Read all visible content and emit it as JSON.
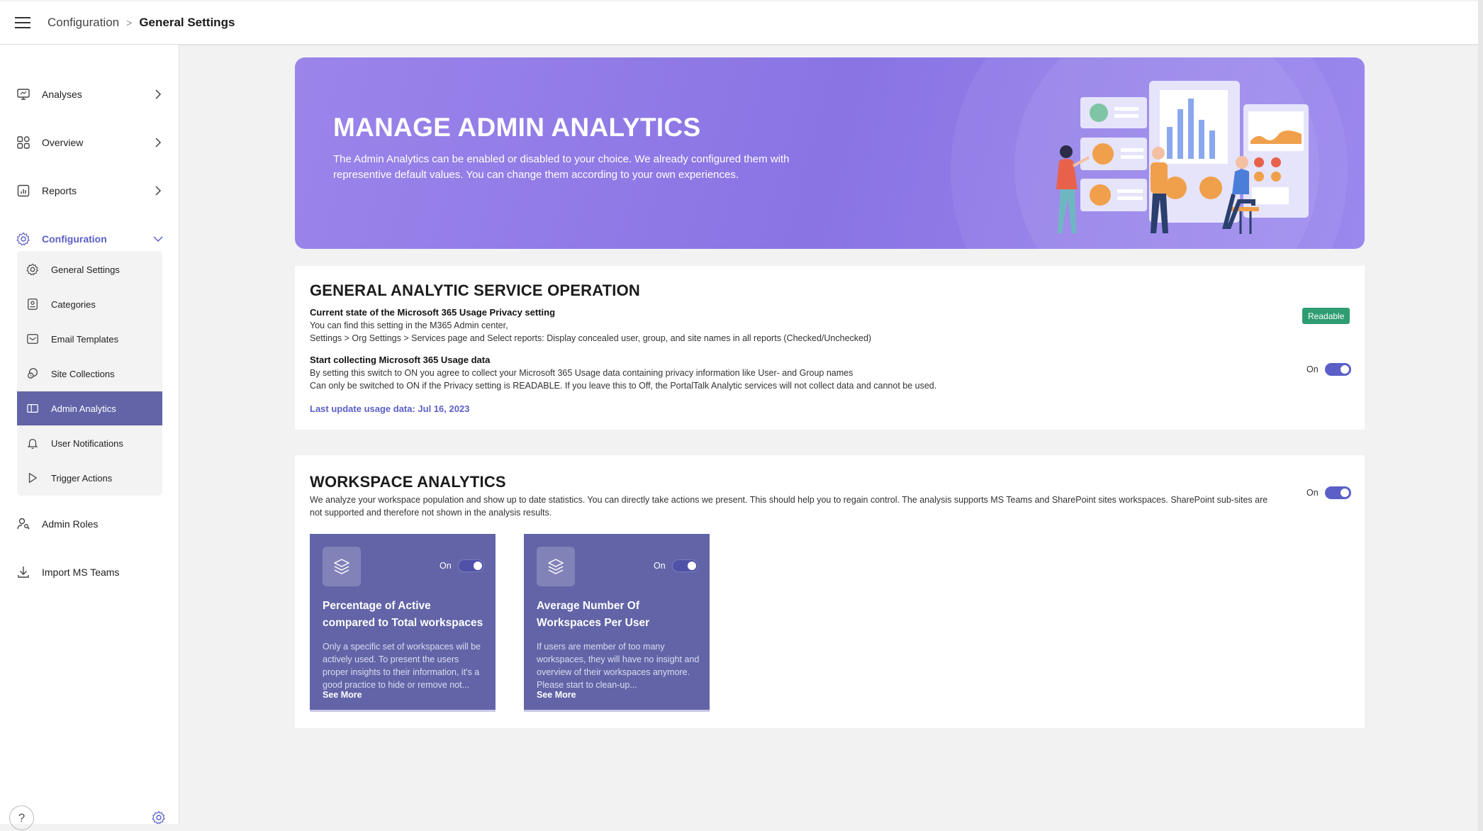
{
  "header": {
    "breadcrumb_parent": "Configuration",
    "breadcrumb_separator": ">",
    "breadcrumb_current": "General Settings"
  },
  "sidebar": {
    "items": [
      {
        "label": "Analyses",
        "icon": "presentation-icon"
      },
      {
        "label": "Overview",
        "icon": "grid-icon"
      },
      {
        "label": "Reports",
        "icon": "report-icon"
      },
      {
        "label": "Configuration",
        "icon": "gear-icon"
      },
      {
        "label": "Admin Roles",
        "icon": "user-key-icon"
      },
      {
        "label": "Import MS Teams",
        "icon": "download-icon"
      }
    ],
    "config_subitems": [
      {
        "label": "General Settings",
        "icon": "gear-icon"
      },
      {
        "label": "Categories",
        "icon": "categories-icon"
      },
      {
        "label": "Email Templates",
        "icon": "mail-icon"
      },
      {
        "label": "Site Collections",
        "icon": "site-collections-icon"
      },
      {
        "label": "Admin Analytics",
        "icon": "analytics-panel-icon"
      },
      {
        "label": "User Notifications",
        "icon": "bell-icon"
      },
      {
        "label": "Trigger Actions",
        "icon": "play-icon"
      }
    ],
    "help_label": "?"
  },
  "hero": {
    "title": "MANAGE ADMIN ANALYTICS",
    "description": "The Admin Analytics can be enabled or disabled to your choice. We already configured them with representive default values. You can change them according to your own experiences."
  },
  "general": {
    "title": "GENERAL ANALYTIC SERVICE OPERATION",
    "privacy_heading": "Current state of the Microsoft 365 Usage Privacy setting",
    "privacy_line1": "You can find this setting in the M365 Admin center,",
    "privacy_line2": "Settings > Org Settings > Services page and Select reports: Display concealed user, group, and site names in all reports (Checked/Unchecked)",
    "privacy_status": "Readable",
    "collect_heading": "Start collecting Microsoft 365 Usage data",
    "collect_line1": "By setting this switch to ON you agree to collect your Microsoft 365 Usage data containing privacy information like User- and Group names",
    "collect_line2": "Can only be switched to ON if the Privacy setting is READABLE. If you leave this to Off, the PortalTalk Analytic services will not collect data and cannot be used.",
    "collect_toggle_label": "On",
    "last_update": "Last update usage data: Jul 16, 2023"
  },
  "workspace": {
    "title": "WORKSPACE ANALYTICS",
    "description": "We analyze your workspace population and show up to date statistics. You can directly take actions we present. This should help you to regain control. The analysis supports MS Teams and SharePoint sites workspaces. SharePoint sub-sites are not supported and therefore not shown in the analysis results.",
    "toggle_label": "On",
    "tiles": [
      {
        "icon": "layers-icon",
        "toggle_label": "On",
        "title": "Percentage of Active compared to Total workspaces",
        "description": "Only a specific set of workspaces will be actively used. To present the users proper insights to their information, it's a good practice to hide or remove not...",
        "more": "See More"
      },
      {
        "icon": "layers-icon",
        "toggle_label": "On",
        "title": "Average Number Of Workspaces Per User",
        "description": "If users are member of too many workspaces, they will have no insight and overview of their workspaces anymore. Please start to clean-up...",
        "more": "See More"
      }
    ]
  },
  "colors": {
    "accent": "#5b5fc7",
    "tile": "#6264a7",
    "hero": "#8a74e4",
    "badge": "#2f9d72"
  }
}
